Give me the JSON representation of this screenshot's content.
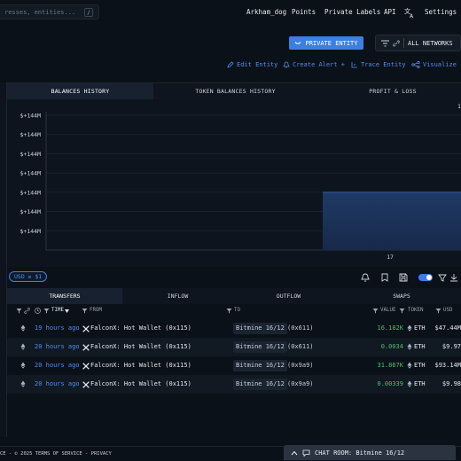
{
  "search": {
    "placeholder": "resses, entities...",
    "shortcut": "/"
  },
  "nav": {
    "user": "Arkham_dog",
    "points": "Points",
    "labels": "Private Labels",
    "api": "API",
    "settings": "Settings"
  },
  "entity_button": "PRIVATE ENTITY",
  "network_button": "ALL NETWORKS",
  "actions": {
    "edit": "Edit Entity",
    "alert": "Create Alert +",
    "trace": "Trace Entity",
    "visualize": "Visualize"
  },
  "chart_tabs": [
    "BALANCES HISTORY",
    "TOKEN BALANCES HISTORY",
    "PROFIT & LOSS"
  ],
  "chart_data": {
    "type": "area",
    "title": "",
    "xlabel": "",
    "ylabel": "",
    "y_ticks": [
      "$+144M",
      "$+144M",
      "$+144M",
      "$+144M",
      "$+144M",
      "$+144M",
      "$+144M"
    ],
    "x_ticks": [
      "17"
    ],
    "right_edge_label": "1",
    "series": [
      {
        "values": [
          0,
          0,
          0,
          0,
          0,
          0,
          144,
          144,
          144,
          144
        ]
      }
    ],
    "grid": true
  },
  "usd_filter": "USD ≥ $1",
  "table_tabs": [
    "TRANSFERS",
    "INFLOW",
    "OUTFLOW",
    "SWAPS"
  ],
  "table_headers": {
    "time": "TIME",
    "from": "FROM",
    "to": "TO",
    "value": "VALUE",
    "token": "TOKEN",
    "usd": "USD"
  },
  "rows": [
    {
      "time": "19 hours ago",
      "from": "FalconX: Hot Wallet (0x115)",
      "to_entity": "Bitmine 16/12",
      "to_addr": "(0x611)",
      "value": "16.182K",
      "token": "ETH",
      "usd": "$47.44M"
    },
    {
      "time": "20 hours ago",
      "from": "FalconX: Hot Wallet (0x115)",
      "to_entity": "Bitmine 16/12",
      "to_addr": "(0x611)",
      "value": "0.0034",
      "token": "ETH",
      "usd": "$9.97"
    },
    {
      "time": "20 hours ago",
      "from": "FalconX: Hot Wallet (0x115)",
      "to_entity": "Bitmine 16/12",
      "to_addr": "(0x9a9)",
      "value": "31.867K",
      "token": "ETH",
      "usd": "$93.14M"
    },
    {
      "time": "20 hours ago",
      "from": "FalconX: Hot Wallet (0x115)",
      "to_entity": "Bitmine 16/12",
      "to_addr": "(0x9a9)",
      "value": "0.00339",
      "token": "ETH",
      "usd": "$9.98"
    }
  ],
  "footer": "CE - © 2025  TERMS OF SERVICE - PRIVACY",
  "chat_button": "CHAT ROOM: Bitmine 16/12"
}
